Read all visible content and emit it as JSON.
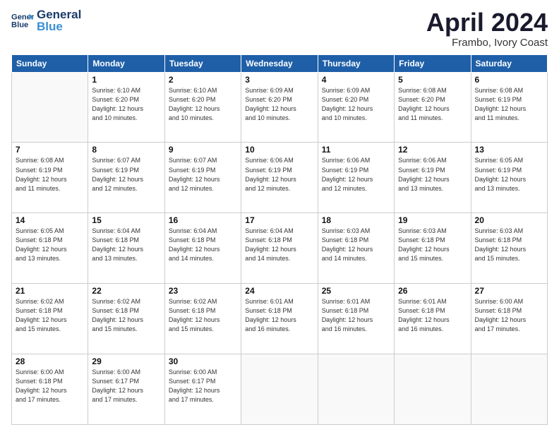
{
  "logo": {
    "line1": "General",
    "line2": "Blue"
  },
  "title": "April 2024",
  "subtitle": "Frambo, Ivory Coast",
  "headers": [
    "Sunday",
    "Monday",
    "Tuesday",
    "Wednesday",
    "Thursday",
    "Friday",
    "Saturday"
  ],
  "weeks": [
    [
      {
        "day": "",
        "info": ""
      },
      {
        "day": "1",
        "info": "Sunrise: 6:10 AM\nSunset: 6:20 PM\nDaylight: 12 hours\nand 10 minutes."
      },
      {
        "day": "2",
        "info": "Sunrise: 6:10 AM\nSunset: 6:20 PM\nDaylight: 12 hours\nand 10 minutes."
      },
      {
        "day": "3",
        "info": "Sunrise: 6:09 AM\nSunset: 6:20 PM\nDaylight: 12 hours\nand 10 minutes."
      },
      {
        "day": "4",
        "info": "Sunrise: 6:09 AM\nSunset: 6:20 PM\nDaylight: 12 hours\nand 10 minutes."
      },
      {
        "day": "5",
        "info": "Sunrise: 6:08 AM\nSunset: 6:20 PM\nDaylight: 12 hours\nand 11 minutes."
      },
      {
        "day": "6",
        "info": "Sunrise: 6:08 AM\nSunset: 6:19 PM\nDaylight: 12 hours\nand 11 minutes."
      }
    ],
    [
      {
        "day": "7",
        "info": "Sunrise: 6:08 AM\nSunset: 6:19 PM\nDaylight: 12 hours\nand 11 minutes."
      },
      {
        "day": "8",
        "info": "Sunrise: 6:07 AM\nSunset: 6:19 PM\nDaylight: 12 hours\nand 12 minutes."
      },
      {
        "day": "9",
        "info": "Sunrise: 6:07 AM\nSunset: 6:19 PM\nDaylight: 12 hours\nand 12 minutes."
      },
      {
        "day": "10",
        "info": "Sunrise: 6:06 AM\nSunset: 6:19 PM\nDaylight: 12 hours\nand 12 minutes."
      },
      {
        "day": "11",
        "info": "Sunrise: 6:06 AM\nSunset: 6:19 PM\nDaylight: 12 hours\nand 12 minutes."
      },
      {
        "day": "12",
        "info": "Sunrise: 6:06 AM\nSunset: 6:19 PM\nDaylight: 12 hours\nand 13 minutes."
      },
      {
        "day": "13",
        "info": "Sunrise: 6:05 AM\nSunset: 6:19 PM\nDaylight: 12 hours\nand 13 minutes."
      }
    ],
    [
      {
        "day": "14",
        "info": "Sunrise: 6:05 AM\nSunset: 6:18 PM\nDaylight: 12 hours\nand 13 minutes."
      },
      {
        "day": "15",
        "info": "Sunrise: 6:04 AM\nSunset: 6:18 PM\nDaylight: 12 hours\nand 13 minutes."
      },
      {
        "day": "16",
        "info": "Sunrise: 6:04 AM\nSunset: 6:18 PM\nDaylight: 12 hours\nand 14 minutes."
      },
      {
        "day": "17",
        "info": "Sunrise: 6:04 AM\nSunset: 6:18 PM\nDaylight: 12 hours\nand 14 minutes."
      },
      {
        "day": "18",
        "info": "Sunrise: 6:03 AM\nSunset: 6:18 PM\nDaylight: 12 hours\nand 14 minutes."
      },
      {
        "day": "19",
        "info": "Sunrise: 6:03 AM\nSunset: 6:18 PM\nDaylight: 12 hours\nand 15 minutes."
      },
      {
        "day": "20",
        "info": "Sunrise: 6:03 AM\nSunset: 6:18 PM\nDaylight: 12 hours\nand 15 minutes."
      }
    ],
    [
      {
        "day": "21",
        "info": "Sunrise: 6:02 AM\nSunset: 6:18 PM\nDaylight: 12 hours\nand 15 minutes."
      },
      {
        "day": "22",
        "info": "Sunrise: 6:02 AM\nSunset: 6:18 PM\nDaylight: 12 hours\nand 15 minutes."
      },
      {
        "day": "23",
        "info": "Sunrise: 6:02 AM\nSunset: 6:18 PM\nDaylight: 12 hours\nand 15 minutes."
      },
      {
        "day": "24",
        "info": "Sunrise: 6:01 AM\nSunset: 6:18 PM\nDaylight: 12 hours\nand 16 minutes."
      },
      {
        "day": "25",
        "info": "Sunrise: 6:01 AM\nSunset: 6:18 PM\nDaylight: 12 hours\nand 16 minutes."
      },
      {
        "day": "26",
        "info": "Sunrise: 6:01 AM\nSunset: 6:18 PM\nDaylight: 12 hours\nand 16 minutes."
      },
      {
        "day": "27",
        "info": "Sunrise: 6:00 AM\nSunset: 6:18 PM\nDaylight: 12 hours\nand 17 minutes."
      }
    ],
    [
      {
        "day": "28",
        "info": "Sunrise: 6:00 AM\nSunset: 6:18 PM\nDaylight: 12 hours\nand 17 minutes."
      },
      {
        "day": "29",
        "info": "Sunrise: 6:00 AM\nSunset: 6:17 PM\nDaylight: 12 hours\nand 17 minutes."
      },
      {
        "day": "30",
        "info": "Sunrise: 6:00 AM\nSunset: 6:17 PM\nDaylight: 12 hours\nand 17 minutes."
      },
      {
        "day": "",
        "info": ""
      },
      {
        "day": "",
        "info": ""
      },
      {
        "day": "",
        "info": ""
      },
      {
        "day": "",
        "info": ""
      }
    ]
  ]
}
